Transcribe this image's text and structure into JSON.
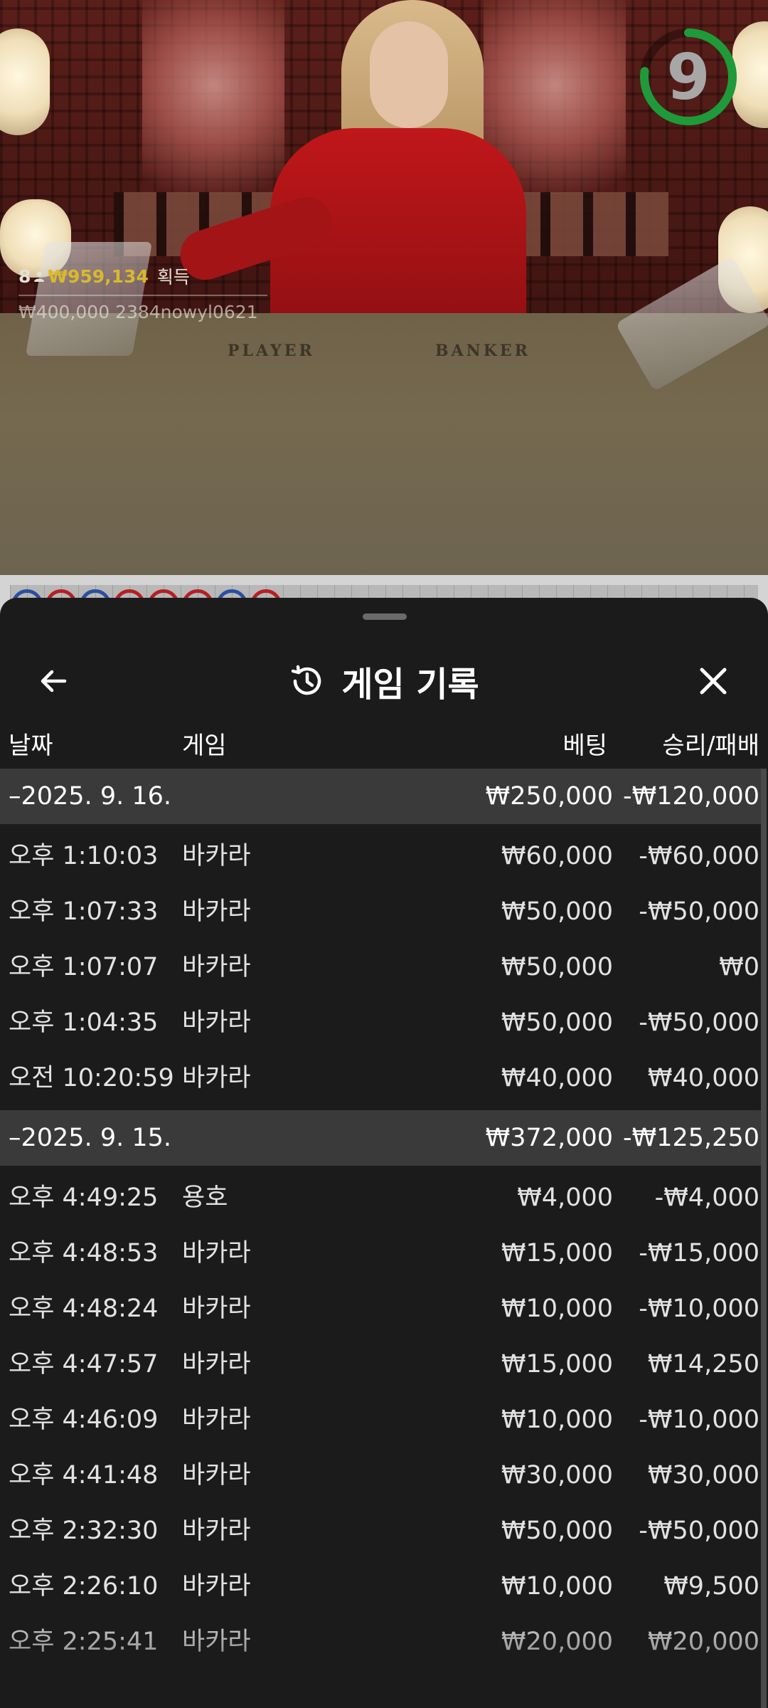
{
  "stream": {
    "timer": "9",
    "winner": {
      "count": "8",
      "amount": "₩959,134",
      "suffix": "획득"
    },
    "bet_ticker": "₩400,000  2384nowyl0621",
    "table_labels": {
      "player": "PLAYER",
      "banker": "BANKER"
    }
  },
  "sheet": {
    "title": "게임 기록",
    "back_icon": "arrow-left-icon",
    "close_icon": "close-icon",
    "title_icon": "history-icon",
    "columns": {
      "date": "날짜",
      "game": "게임",
      "bet": "베팅",
      "result": "승리/패배"
    },
    "groups": [
      {
        "date": "–2025. 9. 16.",
        "bet_total": "₩250,000",
        "result_total": "-₩120,000",
        "rows": [
          {
            "time": "오후 1:10:03",
            "game": "바카라",
            "bet": "₩60,000",
            "result": "-₩60,000"
          },
          {
            "time": "오후 1:07:33",
            "game": "바카라",
            "bet": "₩50,000",
            "result": "-₩50,000"
          },
          {
            "time": "오후 1:07:07",
            "game": "바카라",
            "bet": "₩50,000",
            "result": "₩0"
          },
          {
            "time": "오후 1:04:35",
            "game": "바카라",
            "bet": "₩50,000",
            "result": "-₩50,000"
          },
          {
            "time": "오전 10:20:59",
            "game": "바카라",
            "bet": "₩40,000",
            "result": "₩40,000"
          }
        ]
      },
      {
        "date": "–2025. 9. 15.",
        "bet_total": "₩372,000",
        "result_total": "-₩125,250",
        "rows": [
          {
            "time": "오후 4:49:25",
            "game": "용호",
            "bet": "₩4,000",
            "result": "-₩4,000"
          },
          {
            "time": "오후 4:48:53",
            "game": "바카라",
            "bet": "₩15,000",
            "result": "-₩15,000"
          },
          {
            "time": "오후 4:48:24",
            "game": "바카라",
            "bet": "₩10,000",
            "result": "-₩10,000"
          },
          {
            "time": "오후 4:47:57",
            "game": "바카라",
            "bet": "₩15,000",
            "result": "₩14,250"
          },
          {
            "time": "오후 4:46:09",
            "game": "바카라",
            "bet": "₩10,000",
            "result": "-₩10,000"
          },
          {
            "time": "오후 4:41:48",
            "game": "바카라",
            "bet": "₩30,000",
            "result": "₩30,000"
          },
          {
            "time": "오후 2:32:30",
            "game": "바카라",
            "bet": "₩50,000",
            "result": "-₩50,000"
          },
          {
            "time": "오후 2:26:10",
            "game": "바카라",
            "bet": "₩10,000",
            "result": "₩9,500"
          },
          {
            "time": "오후 2:25:41",
            "game": "바카라",
            "bet": "₩20,000",
            "result": "₩20,000"
          }
        ]
      }
    ]
  },
  "colors": {
    "sheet_bg": "#1b1b1b",
    "group_bg": "#3a3a3a",
    "winner_amount": "#d8b92d",
    "timer_ring": "#1f9a3a"
  }
}
